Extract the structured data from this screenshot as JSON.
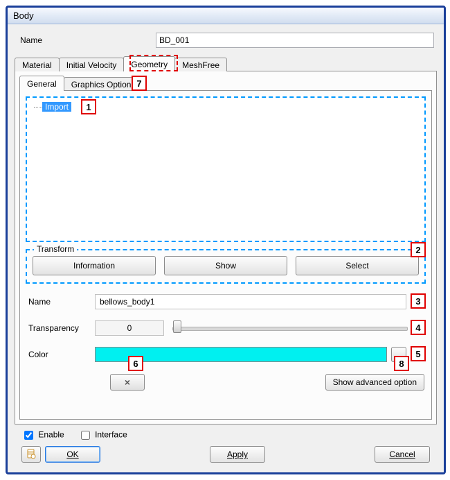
{
  "window": {
    "title": "Body"
  },
  "header": {
    "name_label": "Name",
    "name_value": "BD_001"
  },
  "tabs": {
    "items": [
      "Material",
      "Initial Velocity",
      "Geometry",
      "MeshFree"
    ],
    "active": "Geometry"
  },
  "inner_tabs": {
    "items": [
      "General",
      "Graphics Option"
    ],
    "active": "General"
  },
  "tree": {
    "root": "Import"
  },
  "transform": {
    "legend": "Transform",
    "buttons": {
      "info": "Information",
      "show": "Show",
      "select": "Select"
    }
  },
  "fields": {
    "name_label": "Name",
    "name_value": "bellows_body1",
    "transparency_label": "Transparency",
    "transparency_value": "0",
    "color_label": "Color",
    "color_value": "#00F0F0"
  },
  "bottom": {
    "delete_icon": "×",
    "advanced": "Show advanced option"
  },
  "footer": {
    "enable_label": "Enable",
    "enable_checked": true,
    "interface_label": "Interface",
    "interface_checked": false
  },
  "main_buttons": {
    "ok": "OK",
    "apply": "Apply",
    "cancel": "Cancel"
  },
  "callouts": {
    "c1": "1",
    "c2": "2",
    "c3": "3",
    "c4": "4",
    "c5": "5",
    "c6": "6",
    "c7": "7",
    "c8": "8"
  }
}
